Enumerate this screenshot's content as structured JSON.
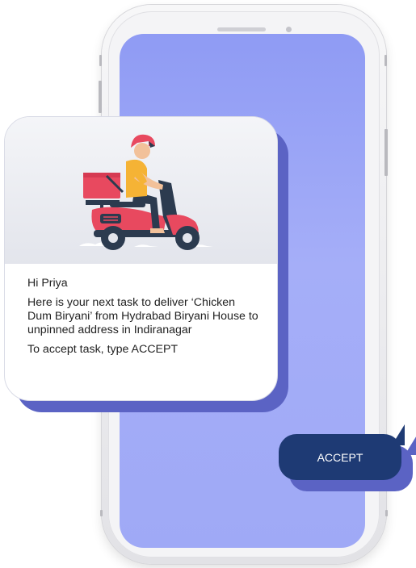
{
  "message": {
    "greeting": "Hi Priya",
    "body": "Here is your next task to deliver ‘Chicken Dum Biryani’ from Hydrabad Biryani House to unpinned address in Indiranagar",
    "instruction": "To accept task, type ACCEPT"
  },
  "reply": {
    "text": "ACCEPT"
  },
  "colors": {
    "screen": "#9fa9f6",
    "bubble": "#1e3a74",
    "shadow": "#5b63c4",
    "scooter": "#e8495f"
  },
  "illustration": {
    "icon": "delivery-scooter-icon"
  }
}
